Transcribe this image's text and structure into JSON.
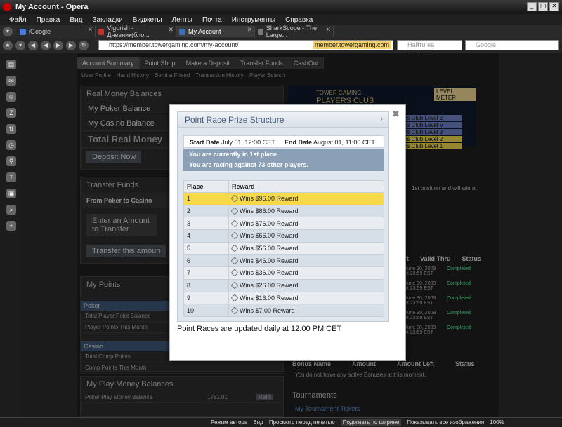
{
  "window": {
    "title": "My Account - Opera",
    "controls": [
      "_",
      "□",
      "✕"
    ]
  },
  "menu": [
    "Файл",
    "Правка",
    "Вид",
    "Закладки",
    "Виджеты",
    "Ленты",
    "Почта",
    "Инструменты",
    "Справка"
  ],
  "tabs": [
    {
      "label": "iGoogle",
      "color": "#4a7bd4"
    },
    {
      "label": "Vigorish - Дневник(бло...",
      "color": "#c03030"
    },
    {
      "label": "My Account",
      "color": "#3a6fbf"
    },
    {
      "label": "SharkScope - The Large...",
      "color": "#777777"
    }
  ],
  "address": {
    "url": "https://member.towergaming.com/my-account/",
    "domain_badge": "member.towergaming.com",
    "find_placeholder": "Найти на странице",
    "search_placeholder": "Google"
  },
  "site": {
    "nav": [
      "Account Summary",
      "Point Shop",
      "Make a Deposit",
      "Transfer Funds",
      "CashOut"
    ],
    "subnav": [
      "User Profile",
      "Hand History",
      "Send a Friend",
      "Transaction History",
      "Player Search"
    ],
    "real_money": {
      "title": "Real Money Balances",
      "rows": [
        "My Poker Balance",
        "My Casino Balance",
        "Total Real Money"
      ],
      "deposit": "Deposit Now"
    },
    "transfer": {
      "title": "Transfer Funds",
      "tab": "From Poker to Casino",
      "tab2": "Fr",
      "amount": "Enter an Amount\nto Transfer",
      "btn": "Transfer this amoun"
    },
    "points": {
      "title": "My Points",
      "poker_hdr": "Poker",
      "poker_rows": [
        "Total Player Point Balance",
        "Player Points This Month"
      ],
      "casino_hdr": "Casino",
      "casino_rows": [
        "Total Comp Points",
        "Comp Points This Month"
      ]
    },
    "play_money": {
      "title": "My Play Money Balances",
      "row": "Poker Play Money Balance",
      "value": "1781.01",
      "refill": "Refill"
    },
    "banner": {
      "brand": "TOWER GAMING",
      "sub": "PLAYERS CLUB",
      "meter": "LEVEL METER",
      "levels": [
        "ayers Club Level E",
        "ayers Club Level V",
        "ayers Club Level 3",
        "ayers Club Level 2",
        "ayers Club Level 1"
      ]
    },
    "right_snippet": "1st position and will win at",
    "offers_cols": [
      "ft",
      "Valid Thru",
      "Status"
    ],
    "offers_rows": [
      {
        "date": "June 30, 2009 at 23:59 EST",
        "status": "Completed"
      },
      {
        "date": "June 30, 2009 at 23:59 EST",
        "status": "Completed"
      },
      {
        "date": "June 30, 2009 at 23:59 EST",
        "status": "Completed"
      },
      {
        "date": "June 30, 2009 at 23:59 EST",
        "status": "Completed"
      },
      {
        "date": "June 30, 2009 at 23:59 EST",
        "status": "Completed"
      }
    ],
    "bonus_cols": [
      "Bonus Name",
      "Amount",
      "Amount Left",
      "Status"
    ],
    "bonus_empty": "You do not have any active Bonuses at this moment.",
    "tournaments": {
      "title": "Tournaments",
      "link": "My Tournament Tickets"
    }
  },
  "modal": {
    "title": "Point Race Prize Structure",
    "start_label": "Start Date",
    "start_value": "July 01, 12:00 CET",
    "end_label": "End Date",
    "end_value": "August 01, 11:00 CET",
    "notice1": "You are currently in 1st place.",
    "notice2": "You are racing against 73 other players.",
    "col_place": "Place",
    "col_reward": "Reward",
    "rows": [
      {
        "place": "1",
        "reward": "Wins $96.00 Reward"
      },
      {
        "place": "2",
        "reward": "Wins $86.00 Reward"
      },
      {
        "place": "3",
        "reward": "Wins $76.00 Reward"
      },
      {
        "place": "4",
        "reward": "Wins $66.00 Reward"
      },
      {
        "place": "5",
        "reward": "Wins $56.00 Reward"
      },
      {
        "place": "6",
        "reward": "Wins $46.00 Reward"
      },
      {
        "place": "7",
        "reward": "Wins $36.00 Reward"
      },
      {
        "place": "8",
        "reward": "Wins $26.00 Reward"
      },
      {
        "place": "9",
        "reward": "Wins $16.00 Reward"
      },
      {
        "place": "10",
        "reward": "Wins $7.00 Reward"
      }
    ],
    "footer": "Point Races are updated daily at 12:00 PM CET"
  },
  "status": {
    "items": [
      "Режим автора",
      "Вид",
      "Просмотр перед печатью",
      "Подогнать по ширине",
      "Показывать все изображения",
      "100%"
    ]
  }
}
